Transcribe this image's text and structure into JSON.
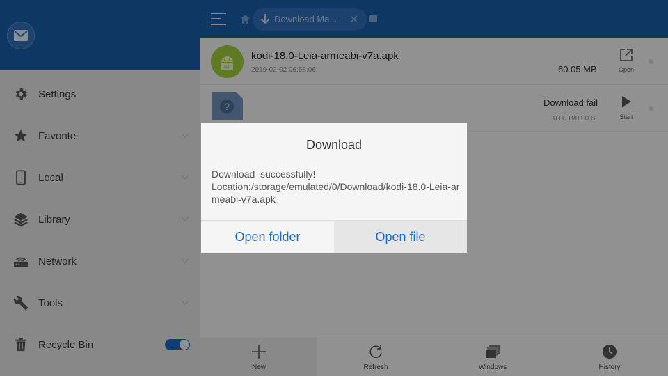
{
  "sidebar": {
    "items": [
      {
        "label": "Settings",
        "icon": "gear-icon"
      },
      {
        "label": "Favorite",
        "icon": "star-icon"
      },
      {
        "label": "Local",
        "icon": "phone-icon"
      },
      {
        "label": "Library",
        "icon": "layers-icon"
      },
      {
        "label": "Network",
        "icon": "router-icon"
      },
      {
        "label": "Tools",
        "icon": "wrench-icon"
      },
      {
        "label": "Recycle Bin",
        "icon": "trash-icon"
      }
    ],
    "recycle_bin_enabled": true
  },
  "header": {
    "breadcrumb": "Download Ma..."
  },
  "downloads": [
    {
      "name": "kodi-18.0-Leia-armeabi-v7a.apk",
      "date": "2019-02-02 06:58:06",
      "size": "60.05 MB",
      "action": "Open",
      "badge": "APK"
    },
    {
      "name": "",
      "status": "Download fail",
      "progress": "0.00 B/0.00 B",
      "action": "Start"
    }
  ],
  "bottombar": {
    "new": "New",
    "refresh": "Refresh",
    "windows": "Windows",
    "history": "History"
  },
  "dialog": {
    "title": "Download",
    "line1": "Download  successfully!",
    "line2": "Location:/storage/emulated/0/Download/kodi-18.0-Leia-armeabi-v7a.apk",
    "open_folder": "Open folder",
    "open_file": "Open file"
  },
  "colors": {
    "primary_blue": "#1a5da6",
    "accent_blue": "#1e6bbf",
    "apk_green": "#9fcb3b"
  }
}
